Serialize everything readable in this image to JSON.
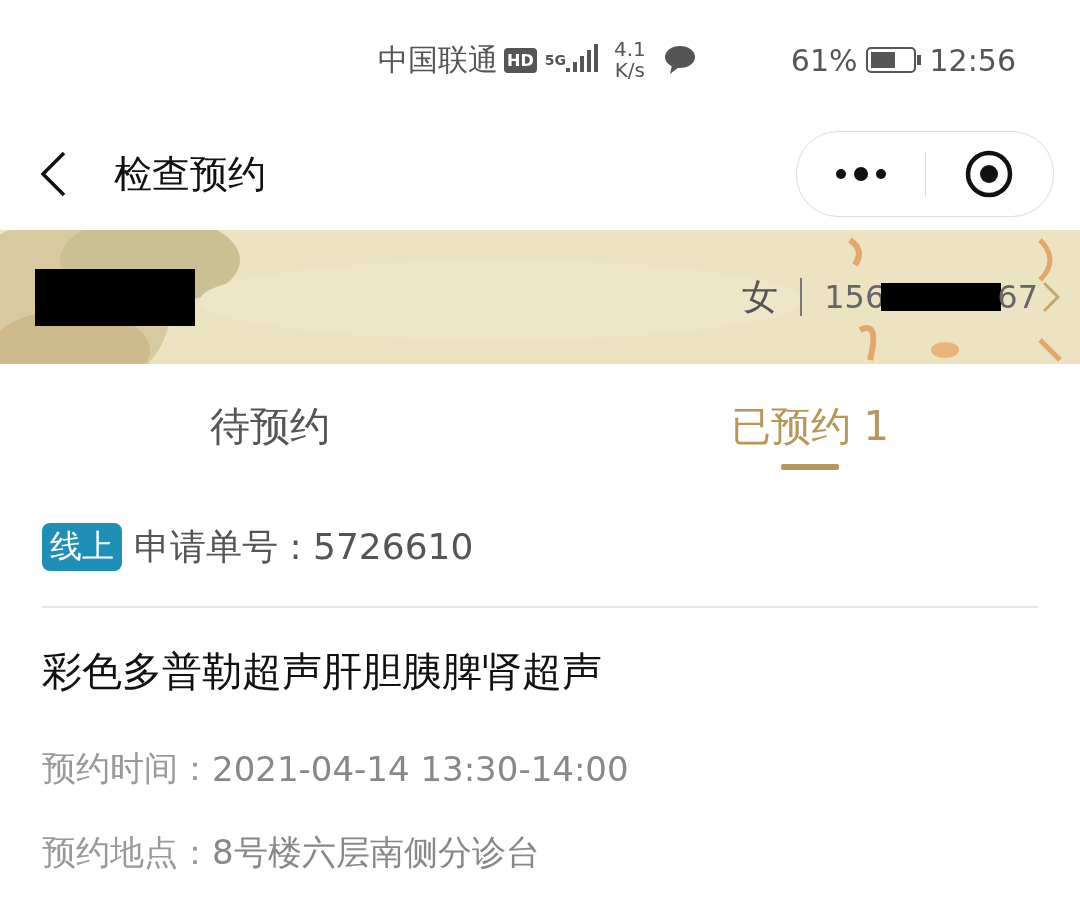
{
  "status_bar": {
    "carrier": "中国联通",
    "hd": "HD",
    "network": "5G",
    "speed_value": "4.1",
    "speed_unit": "K/s",
    "battery_text": "61%",
    "time": "12:56"
  },
  "nav": {
    "title": "检查预约"
  },
  "patient": {
    "name_redacted": true,
    "gender": "女",
    "phone_start": "156",
    "phone_end": "67",
    "phone_redacted": true
  },
  "tabs": [
    {
      "label": "待预约",
      "selected": false
    },
    {
      "label": "已预约 1",
      "selected": true
    }
  ],
  "appointments": [
    {
      "tag": "线上",
      "order_label": "申请单号 : 5726610",
      "exam": "彩色多普勒超声肝胆胰脾肾超声",
      "time_label": "预约时间：",
      "time_value": "2021-04-14 13:30-14:00",
      "place_label": "预约地点：",
      "place_value": "8号楼六层南侧分诊台"
    }
  ]
}
